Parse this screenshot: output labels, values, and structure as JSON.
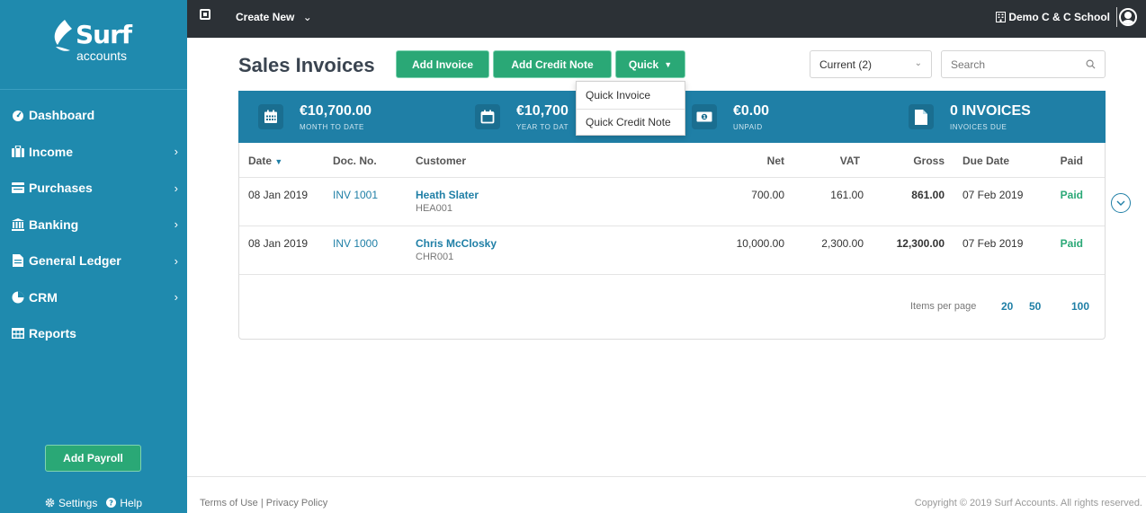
{
  "sidebar": {
    "logo_name": "Surf",
    "logo_sub": "accounts",
    "items": [
      {
        "label": "Dashboard",
        "icon": "dashboard-icon",
        "chevron": false
      },
      {
        "label": "Income",
        "icon": "briefcase-icon",
        "chevron": true
      },
      {
        "label": "Purchases",
        "icon": "card-icon",
        "chevron": true
      },
      {
        "label": "Banking",
        "icon": "bank-icon",
        "chevron": true
      },
      {
        "label": "General Ledger",
        "icon": "document-icon",
        "chevron": true
      },
      {
        "label": "CRM",
        "icon": "pie-icon",
        "chevron": true
      },
      {
        "label": "Reports",
        "icon": "table-icon",
        "chevron": false
      }
    ],
    "payroll_button": "Add Payroll",
    "settings": "Settings",
    "help": "Help"
  },
  "topbar": {
    "create_new": "Create New",
    "school": "Demo C & C School"
  },
  "header": {
    "title": "Sales Invoices",
    "add_invoice": "Add Invoice",
    "add_credit_note": "Add Credit Note",
    "quick": "Quick",
    "filter_value": "Current (2)",
    "search_placeholder": "Search"
  },
  "quick_menu": [
    "Quick Invoice",
    "Quick Credit Note"
  ],
  "stats": [
    {
      "value": "€10,700.00",
      "label": "MONTH TO DATE",
      "icon": "calendar-icon"
    },
    {
      "value": "€10,700",
      "label": "YEAR TO DAT",
      "icon": "calendar-outline-icon"
    },
    {
      "value": "€0.00",
      "label": "UNPAID",
      "icon": "money-icon"
    },
    {
      "value": "0 INVOICES",
      "label": "INVOICES DUE",
      "icon": "file-icon"
    }
  ],
  "table": {
    "columns": [
      "Date",
      "Doc. No.",
      "Customer",
      "Net",
      "VAT",
      "Gross",
      "Due Date",
      "Paid"
    ],
    "rows": [
      {
        "date": "08 Jan 2019",
        "doc": "INV 1001",
        "customer": "Heath Slater",
        "code": "HEA001",
        "net": "700.00",
        "vat": "161.00",
        "gross": "861.00",
        "due": "07 Feb 2019",
        "paid": "Paid"
      },
      {
        "date": "08 Jan 2019",
        "doc": "INV 1000",
        "customer": "Chris McClosky",
        "code": "CHR001",
        "net": "10,000.00",
        "vat": "2,300.00",
        "gross": "12,300.00",
        "due": "07 Feb 2019",
        "paid": "Paid"
      }
    ],
    "items_per_page_label": "Items per page",
    "page_sizes": [
      "20",
      "50",
      "100"
    ]
  },
  "footer": {
    "links": "Terms of Use | Privacy Policy",
    "copyright": "Copyright © 2019 Surf Accounts. All rights reserved."
  },
  "colors": {
    "sidebar": "#1f8aae",
    "topbar": "#2c3136",
    "accent_green": "#2aa876",
    "stats_bg": "#1f7fa6"
  }
}
